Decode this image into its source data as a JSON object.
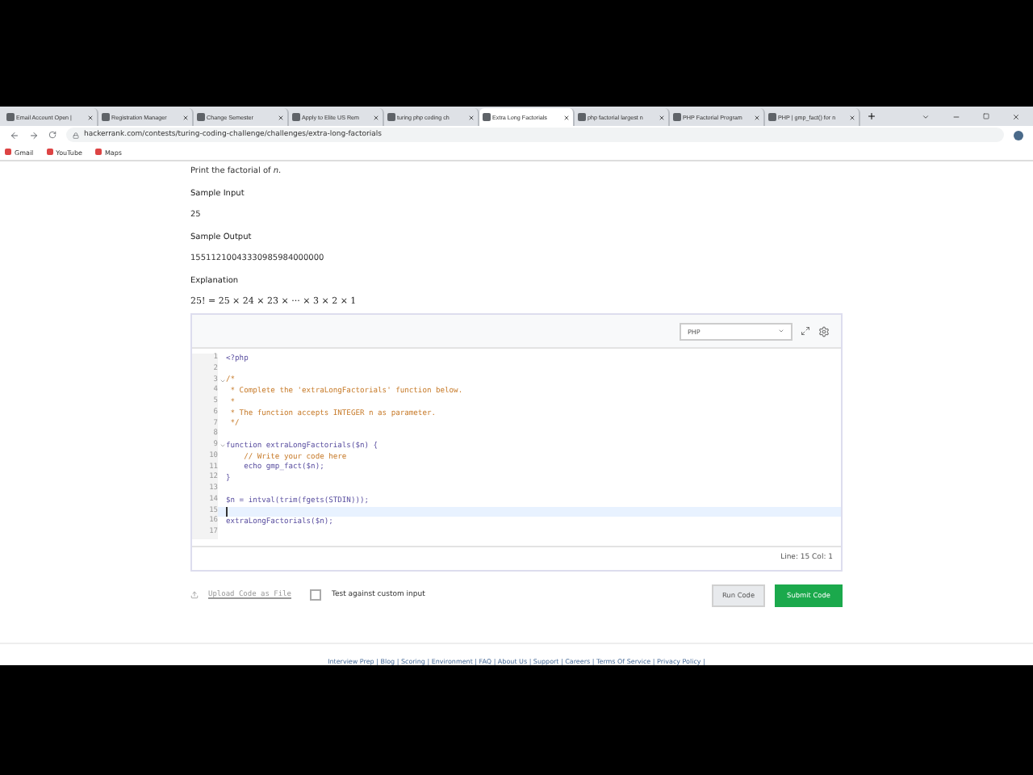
{
  "browser": {
    "tabs": [
      {
        "title": "Email Account Open |",
        "selected": false
      },
      {
        "title": "Registration Manager",
        "selected": false
      },
      {
        "title": "Change Semester",
        "selected": false
      },
      {
        "title": "Apply to Elite US Rem",
        "selected": false
      },
      {
        "title": "turing php coding ch",
        "selected": false
      },
      {
        "title": "Extra Long Factorials",
        "selected": true
      },
      {
        "title": "php factorial largest n",
        "selected": false
      },
      {
        "title": "PHP Factorial Program",
        "selected": false
      },
      {
        "title": "PHP | gmp_fact() for n",
        "selected": false
      }
    ],
    "url": "hackerrank.com/contests/turing-coding-challenge/challenges/extra-long-factorials",
    "bookmarks": [
      "Gmail",
      "YouTube",
      "Maps"
    ]
  },
  "problem": {
    "statement": "Print the factorial of *n*.",
    "sections": [
      {
        "heading": "Sample Input",
        "body": "25",
        "kind": "plain"
      },
      {
        "heading": "Sample Output",
        "body": "15511210043330985984000000",
        "kind": "plain"
      },
      {
        "heading": "Explanation",
        "body": "25! = 25 × 24 × 23 × ··· × 3 × 2 × 1",
        "kind": "math"
      }
    ]
  },
  "editor": {
    "language": "PHP",
    "status": "Line: 15 Col: 1",
    "lines": [
      {
        "num": "1",
        "text": "<?php",
        "kind": "code",
        "fold": false,
        "current": false
      },
      {
        "num": "2",
        "fold": false,
        "current": false
      },
      {
        "num": "3",
        "text": "/*",
        "kind": "comment",
        "fold": true,
        "current": false
      },
      {
        "num": "4",
        "text": " * Complete the 'extraLongFactorials' function below.",
        "kind": "comment",
        "fold": false,
        "current": false
      },
      {
        "num": "5",
        "text": " *",
        "kind": "comment",
        "fold": false,
        "current": false
      },
      {
        "num": "6",
        "text": " * The function accepts INTEGER n as parameter.",
        "kind": "comment",
        "fold": false,
        "current": false
      },
      {
        "num": "7",
        "text": " */",
        "kind": "comment",
        "fold": false,
        "current": false
      },
      {
        "num": "8",
        "fold": false,
        "current": false
      },
      {
        "num": "9",
        "text": "function extraLongFactorials($n) {",
        "kind": "code",
        "fold": true,
        "current": false
      },
      {
        "num": "10",
        "text": "    // Write your code here",
        "kind": "comment",
        "fold": false,
        "current": false
      },
      {
        "num": "11",
        "text": "    echo gmp_fact($n);",
        "kind": "code",
        "fold": false,
        "current": false
      },
      {
        "num": "12",
        "text": "}",
        "kind": "code",
        "fold": false,
        "current": false
      },
      {
        "num": "13",
        "fold": false,
        "current": false
      },
      {
        "num": "14",
        "text": "$n = intval(trim(fgets(STDIN)));",
        "kind": "code",
        "fold": false,
        "current": false
      },
      {
        "num": "15",
        "fold": false,
        "current": true
      },
      {
        "num": "16",
        "text": "extraLongFactorials($n);",
        "kind": "code",
        "fold": false,
        "current": false
      },
      {
        "num": "17",
        "fold": false,
        "current": false
      }
    ]
  },
  "actions": {
    "upload": "Upload Code as File",
    "custom_input": {
      "label": "Test against custom input",
      "checked": false
    },
    "run": "Run Code",
    "submit": "Submit Code"
  },
  "footer": "Interview Prep | Blog | Scoring | Environment | FAQ | About Us | Support | Careers | Terms Of Service | Privacy Policy |"
}
